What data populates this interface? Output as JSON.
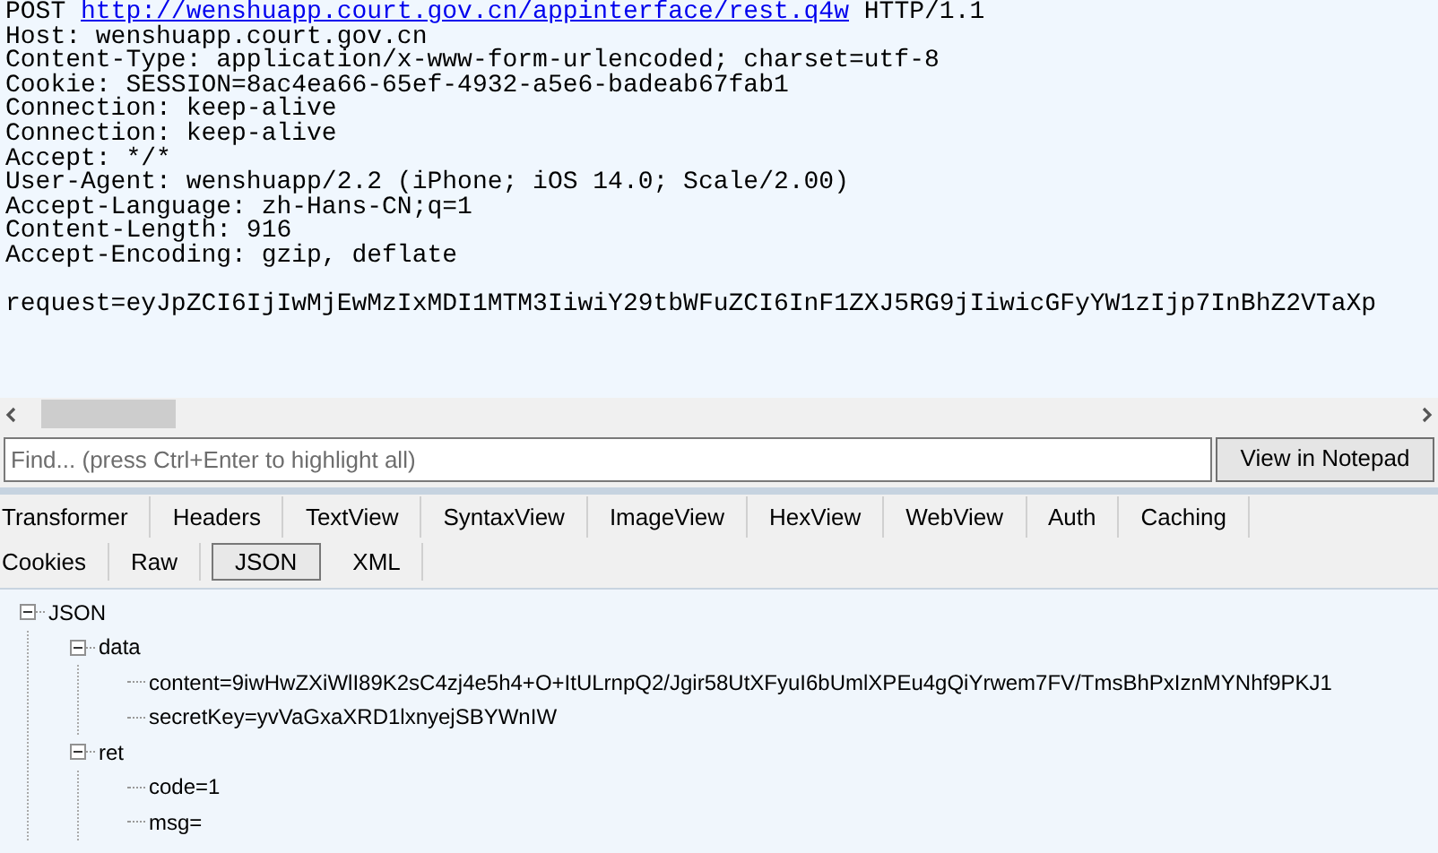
{
  "request_view": {
    "request_line": {
      "method": "POST",
      "url": "http://wenshuapp.court.gov.cn/appinterface/rest.q4w",
      "version": "HTTP/1.1"
    },
    "headers": [
      "Host: wenshuapp.court.gov.cn",
      "Content-Type: application/x-www-form-urlencoded; charset=utf-8",
      "Cookie: SESSION=8ac4ea66-65ef-4932-a5e6-badeab67fab1",
      "Connection: keep-alive",
      "Connection: keep-alive",
      "Accept: */*",
      "User-Agent: wenshuapp/2.2 (iPhone; iOS 14.0; Scale/2.00)",
      "Accept-Language: zh-Hans-CN;q=1",
      "Content-Length: 916",
      "Accept-Encoding: gzip, deflate"
    ],
    "body": "request=eyJpZCI6IjIwMjEwMzIxMDI1MTM3IiwiY29tbWFuZCI6InF1ZXJ5RG9jIiwicGFyYW1zIjp7InBhZ2VTaXp"
  },
  "find_bar": {
    "placeholder": "Find... (press Ctrl+Enter to highlight all)",
    "button": "View in Notepad"
  },
  "tabs": [
    {
      "label": "Transformer",
      "selected": false
    },
    {
      "label": "Headers",
      "selected": false
    },
    {
      "label": "TextView",
      "selected": false
    },
    {
      "label": "SyntaxView",
      "selected": false
    },
    {
      "label": "ImageView",
      "selected": false
    },
    {
      "label": "HexView",
      "selected": false
    },
    {
      "label": "WebView",
      "selected": false
    },
    {
      "label": "Auth",
      "selected": false
    },
    {
      "label": "Caching",
      "selected": false
    }
  ],
  "subtabs": [
    {
      "label": "Cookies",
      "selected": false
    },
    {
      "label": "Raw",
      "selected": false
    },
    {
      "label": "JSON",
      "selected": true
    },
    {
      "label": "XML",
      "selected": false
    }
  ],
  "tree": [
    {
      "label": "JSON",
      "expanded": true,
      "children": [
        {
          "label": "data",
          "expanded": true,
          "children": [
            {
              "label": "content=9iwHwZXiWlI89K2sC4zj4e5h4+O+ItULrnpQ2/Jgir58UtXFyuI6bUmlXPEu4gQiYrwem7FV/TmsBhPxIznMYNhf9PKJ1"
            },
            {
              "label": "secretKey=yvVaGxaXRD1lxnyejSBYWnIW"
            }
          ]
        },
        {
          "label": "ret",
          "expanded": true,
          "children": [
            {
              "label": "code=1"
            },
            {
              "label": "msg="
            }
          ]
        }
      ]
    }
  ]
}
